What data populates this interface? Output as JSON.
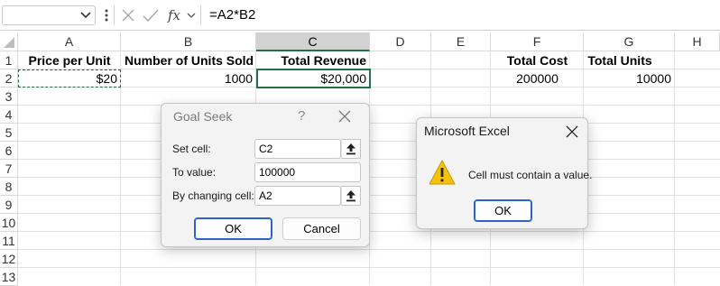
{
  "formula_bar": {
    "name_box_value": "",
    "formula": "=A2*B2",
    "fx_label": "fx"
  },
  "columns": [
    "A",
    "B",
    "C",
    "D",
    "E",
    "F",
    "G",
    "H"
  ],
  "selected_column": "C",
  "rows": [
    "1",
    "2",
    "3",
    "4",
    "5",
    "6",
    "7",
    "8",
    "9",
    "10",
    "11",
    "12",
    "13"
  ],
  "cells": {
    "A1": "Price per Unit",
    "B1": "Number of Units Sold",
    "C1": "Total Revenue",
    "F1": "Total Cost",
    "G1": "Total Units",
    "A2": "$20",
    "B2": "1000",
    "C2": "$20,000",
    "F2": "200000",
    "G2": "10000"
  },
  "goal_seek": {
    "title": "Goal Seek",
    "help": "?",
    "set_cell_label": "Set cell:",
    "set_cell_value": "C2",
    "to_value_label": "To value:",
    "to_value_value": "100000",
    "changing_cell_label": "By changing cell:",
    "changing_cell_value": "A2",
    "ok_label": "OK",
    "cancel_label": "Cancel"
  },
  "message_box": {
    "title": "Microsoft Excel",
    "message": "Cell must contain a value.",
    "ok_label": "OK",
    "icon": "warning-icon",
    "warning_color": "#f4c20d"
  },
  "colors": {
    "excel_green": "#217346",
    "dialog_bg": "#f3f3f3",
    "focus_blue": "#2b63c8"
  }
}
